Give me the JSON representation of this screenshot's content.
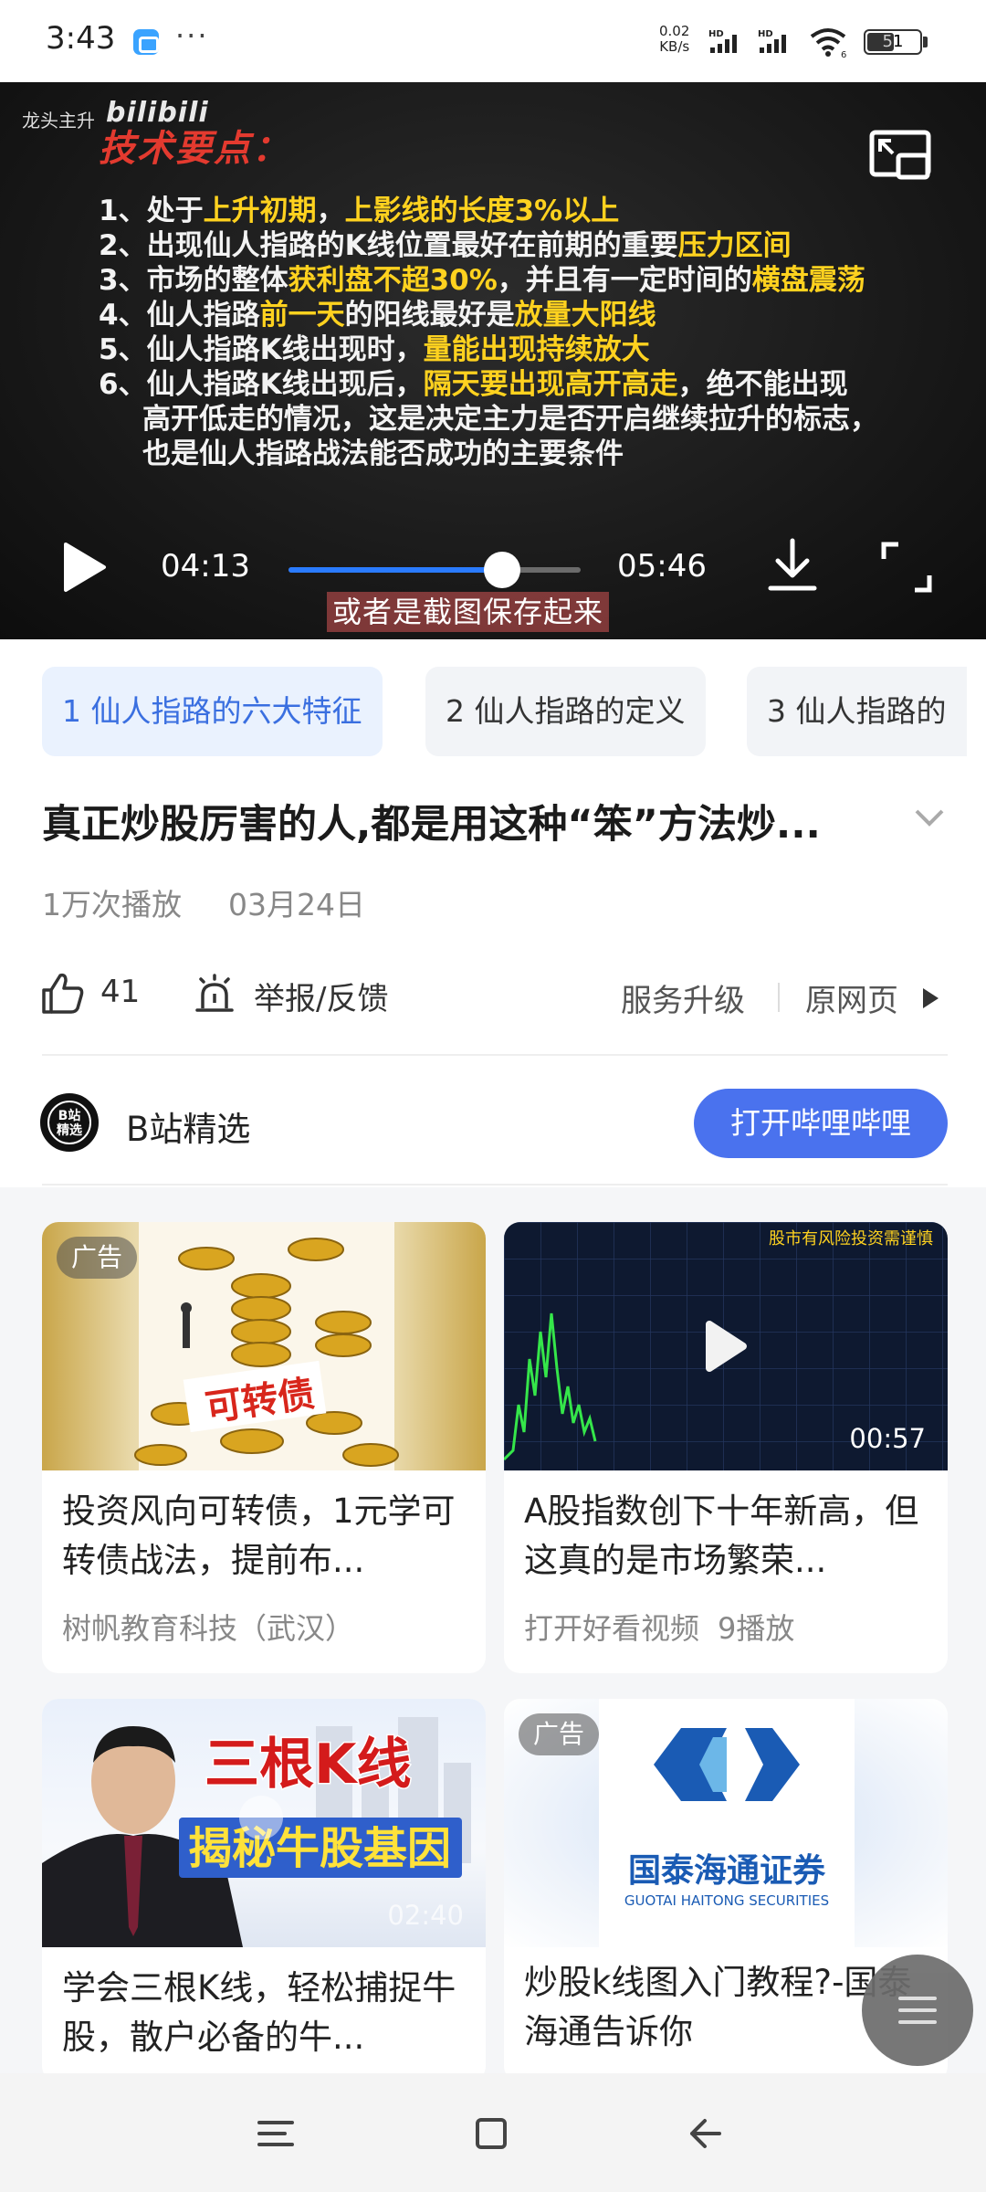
{
  "status_bar": {
    "time": "3:43",
    "more": "···",
    "net_speed_value": "0.02",
    "net_speed_unit": "KB/s",
    "signal_1_label": "HD",
    "signal_2_label": "HD",
    "wifi_sub": "6",
    "battery": "51",
    "battery_level": 0.51
  },
  "player": {
    "watermark_left": "龙头主升",
    "watermark_logo": "bilibili",
    "slide_title": "技术要点：",
    "slide_lines": [
      {
        "a": "1、处于",
        "h1": "上升初期",
        "b": "，",
        "h2": "上影线的长度3%以上",
        "c": ""
      },
      {
        "a": "2、出现仙人指路的K线位置最好在前期的重要",
        "h1": "压力区间",
        "b": "",
        "h2": "",
        "c": ""
      },
      {
        "a": "3、市场的整体",
        "h1": "获利盘不超30%",
        "b": "，并且有一定时间的",
        "h2": "横盘震荡",
        "c": ""
      },
      {
        "a": "4、仙人指路",
        "h1": "前一天",
        "b": "的阳线最好是",
        "h2": "放量大阳线",
        "c": ""
      },
      {
        "a": "5、仙人指路K线出现时，",
        "h1": "量能出现持续放大",
        "b": "",
        "h2": "",
        "c": ""
      },
      {
        "a": "6、仙人指路K线出现后，",
        "h1": "隔天要出现高开高走",
        "b": "，绝不能出现",
        "h2": "",
        "c": ""
      }
    ],
    "slide_cont_1": "高开低走的情况，这是决定主力是否开启继续拉升的标志，",
    "slide_cont_2": "也是仙人指路战法能否成功的主要条件",
    "current_time": "04:13",
    "duration": "05:46",
    "progress": 0.7306,
    "subtitle": "或者是截图保存起来",
    "progress_color": "#2a7bff"
  },
  "chapters": [
    "1 仙人指路的六大特征",
    "2 仙人指路的定义",
    "3 仙人指路的"
  ],
  "video": {
    "title": "真正炒股厉害的人,都是用这种“笨”方法炒...",
    "plays": "1万次播放",
    "date": "03月24日",
    "likes": "41",
    "report": "举报/反馈",
    "service_upgrade": "服务升级",
    "original_page": "原网页"
  },
  "channel": {
    "avatar_text_1": "B站",
    "avatar_text_2": "精选",
    "name": "B站精选",
    "open_button": "打开哔哩哔哩",
    "button_color": "#4a72ee"
  },
  "feed": [
    {
      "ad_badge": "广告",
      "thumb_text": "可转债",
      "title": "投资风向可转债，1元学可转债战法，提前布...",
      "sub": "树帆教育科技（武汉）"
    },
    {
      "thumb_text": "股市有风险投资需谨慎",
      "duration": "00:57",
      "title": "A股指数创下十年新高，但这真的是市场繁荣...",
      "sub_source": "打开好看视频",
      "sub_plays": "9播放"
    },
    {
      "thumb_text_1": "三根K线",
      "thumb_text_2": "揭秘牛股基因",
      "duration": "02:40",
      "title": "学会三根K线，轻松捕捉牛股，散户必备的牛..."
    },
    {
      "ad_badge": "广告",
      "thumb_text_cn": "国泰海通证券",
      "thumb_text_en": "GUOTAI HAITONG SECURITIES",
      "title": "炒股k线图入门教程?-国泰海通告诉你"
    }
  ],
  "icons": {
    "pip": "picture-in-picture-icon",
    "play": "play-icon",
    "download": "download-icon",
    "fullscreen": "fullscreen-icon",
    "like": "thumbs-up-icon",
    "report": "alarm-report-icon",
    "arrow": "play-arrow-icon",
    "chevron": "chevron-down-icon",
    "menu": "menu-icon",
    "home": "square-home-icon",
    "back": "back-arrow-icon"
  }
}
